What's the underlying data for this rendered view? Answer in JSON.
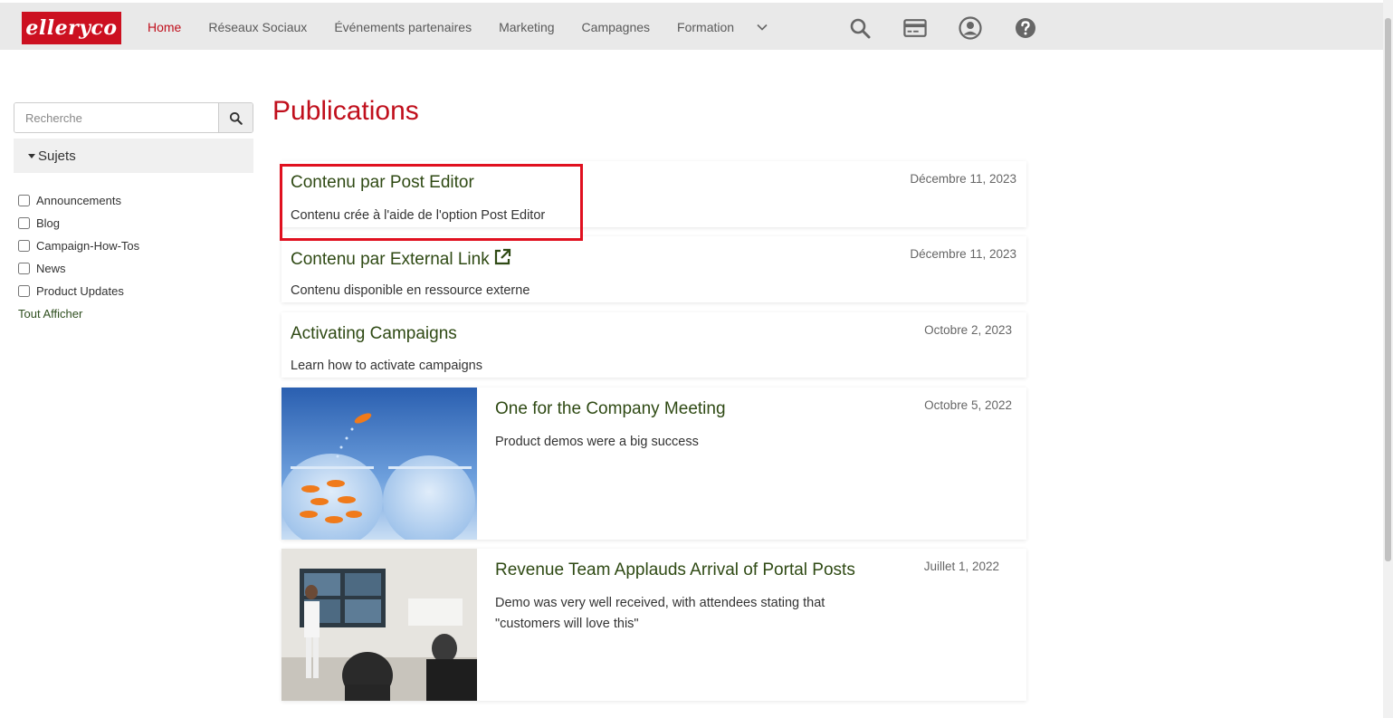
{
  "brand": {
    "logo_text": "elleryco",
    "accent": "#c00f1c"
  },
  "nav": {
    "items": [
      {
        "label": "Home",
        "active": true
      },
      {
        "label": "Réseaux Sociaux"
      },
      {
        "label": "Événements partenaires"
      },
      {
        "label": "Marketing"
      },
      {
        "label": "Campagnes"
      },
      {
        "label": "Formation"
      }
    ],
    "more_icon": "chevron-down-icon",
    "icons": [
      "search-icon",
      "credit-card-icon",
      "user-circle-icon",
      "help-circle-icon"
    ]
  },
  "sidebar": {
    "search_placeholder": "Recherche",
    "topics_header": "Sujets",
    "topics": [
      {
        "label": "Announcements",
        "checked": false
      },
      {
        "label": "Blog",
        "checked": false
      },
      {
        "label": "Campaign-How-Tos",
        "checked": false
      },
      {
        "label": "News",
        "checked": false
      },
      {
        "label": "Product Updates",
        "checked": false
      }
    ],
    "show_all": "Tout Afficher"
  },
  "main": {
    "title": "Publications",
    "posts": [
      {
        "title": "Contenu par Post Editor",
        "description": "Contenu crée à l'aide de l'option Post Editor",
        "date": "Décembre 11, 2023",
        "highlighted": true
      },
      {
        "title": "Contenu par External Link",
        "description": "Contenu disponible en ressource externe",
        "date": "Décembre 11, 2023",
        "external": true
      },
      {
        "title": "Activating Campaigns",
        "description": "Learn how to activate campaigns",
        "date": "Octobre 2, 2023"
      },
      {
        "title": "One for the Company Meeting",
        "description": "Product demos were a big success",
        "date": "Octobre 5, 2022",
        "image": "goldfish-jumping-bowl"
      },
      {
        "title": "Revenue Team Applauds Arrival of Portal Posts",
        "description_line1": "Demo was very well received, with attendees stating that",
        "description_line2": "\"customers will love this\"",
        "date": "Juillet 1, 2022",
        "image": "presentation-meeting"
      }
    ]
  }
}
